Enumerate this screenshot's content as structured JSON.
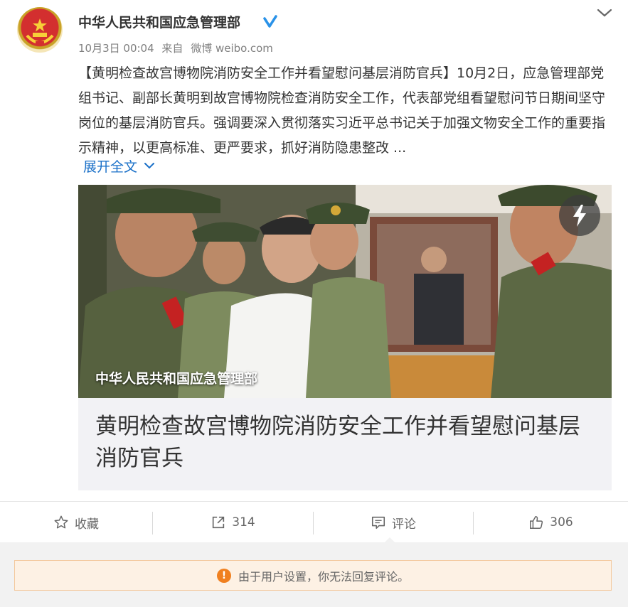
{
  "post": {
    "author": "中华人民共和国应急管理部",
    "date": "10月3日 00:04",
    "source_prefix": "来自",
    "source": "微博 weibo.com",
    "text": "【黄明检查故宫博物院消防安全工作并看望慰问基层消防官兵】10月2日，应急管理部党组书记、副部长黄明到故宫博物院检查消防安全工作，代表部党组看望慰问节日期间坚守岗位的基层消防官兵。强调要深入贯彻落实习近平总书记关于加强文物安全工作的重要指示精神，以更高标准、更严要求，抓好消防隐患整改 ...",
    "expand_label": "展开全文"
  },
  "media": {
    "watermark": "中华人民共和国应急管理部",
    "caption": "黄明检查故宫博物院消防安全工作并看望慰问基层消防官兵"
  },
  "actions": {
    "favorite_label": "收藏",
    "repost_count": "314",
    "comment_label": "评论",
    "like_count": "306"
  },
  "notice": {
    "text": "由于用户设置，你无法回复评论。"
  },
  "colors": {
    "link": "#1a70c8",
    "verified": "#2a92e8",
    "notice_bg": "#fdf1e4",
    "notice_icon": "#f08020"
  }
}
